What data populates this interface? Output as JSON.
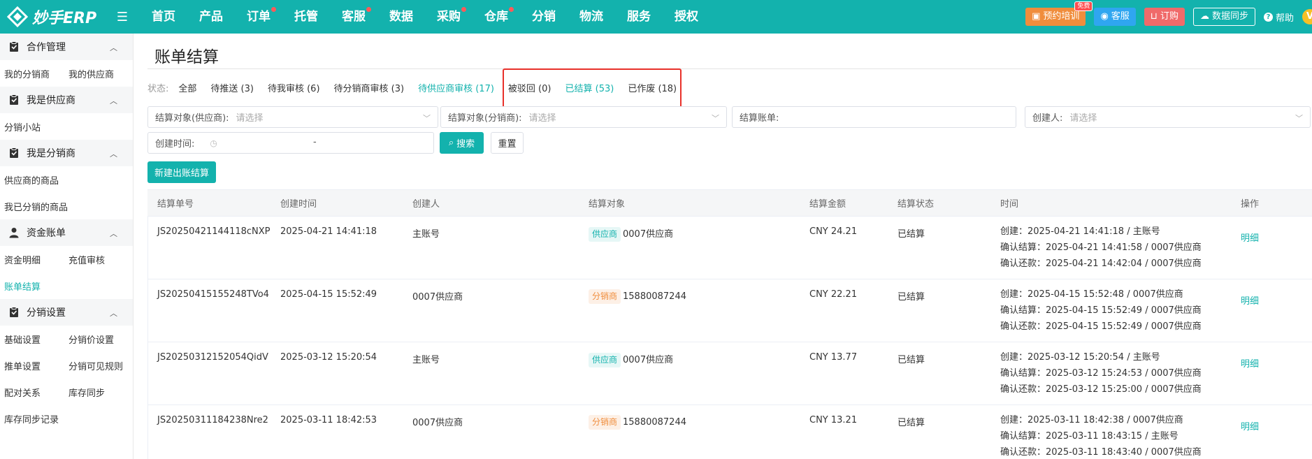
{
  "app": {
    "logo_text": "妙手ERP"
  },
  "nav": {
    "items": [
      {
        "label": "首页",
        "dot": false
      },
      {
        "label": "产品",
        "dot": false
      },
      {
        "label": "订单",
        "dot": true
      },
      {
        "label": "托管",
        "dot": false
      },
      {
        "label": "客服",
        "dot": true
      },
      {
        "label": "数据",
        "dot": false
      },
      {
        "label": "采购",
        "dot": true
      },
      {
        "label": "仓库",
        "dot": true
      },
      {
        "label": "分销",
        "dot": false
      },
      {
        "label": "物流",
        "dot": false
      },
      {
        "label": "服务",
        "dot": false
      },
      {
        "label": "授权",
        "dot": false
      }
    ]
  },
  "topright": {
    "training": "预约培训",
    "free_badge": "免费",
    "service": "客服",
    "order": "订购",
    "sync": "数据同步",
    "help": "帮助",
    "vip": "V"
  },
  "sidebar": {
    "groups": [
      {
        "title": "合作管理",
        "icon": "clipboard-icon",
        "rows": [
          [
            "我的分销商",
            "我的供应商"
          ]
        ]
      },
      {
        "title": "我是供应商",
        "icon": "clipboard-icon",
        "rows": [
          [
            "分销小站"
          ]
        ]
      },
      {
        "title": "我是分销商",
        "icon": "clipboard-icon",
        "rows": [
          [
            "供应商的商品"
          ],
          [
            "我已分销的商品"
          ]
        ]
      },
      {
        "title": "资金账单",
        "icon": "user-icon",
        "rows": [
          [
            "资金明细",
            "充值审核"
          ],
          [
            "账单结算"
          ]
        ]
      },
      {
        "title": "分销设置",
        "icon": "clipboard-icon",
        "rows": [
          [
            "基础设置",
            "分销价设置"
          ],
          [
            "推单设置",
            "分销可见规则"
          ],
          [
            "配对关系",
            "库存同步"
          ],
          [
            "库存同步记录"
          ]
        ]
      }
    ],
    "active_item": "账单结算"
  },
  "page": {
    "title": "账单结算",
    "status_label": "状态:",
    "status_tabs": [
      {
        "label": "全部",
        "active": false
      },
      {
        "label": "待推送 (3)",
        "active": false
      },
      {
        "label": "待我审核 (6)",
        "active": false
      },
      {
        "label": "待分销商审核 (3)",
        "active": false
      },
      {
        "label": "待供应商审核 (17)",
        "active": true
      },
      {
        "label": "被驳回 (0)",
        "active": false
      },
      {
        "label": "已结算 (53)",
        "active": true
      },
      {
        "label": "已作废 (18)",
        "active": false
      }
    ]
  },
  "filters": {
    "supplier": {
      "label": "结算对象(供应商):",
      "placeholder": "请选择"
    },
    "distributor": {
      "label": "结算对象(分销商):",
      "placeholder": "请选择"
    },
    "bill": {
      "label": "结算账单:",
      "placeholder": ""
    },
    "creator": {
      "label": "创建人:",
      "placeholder": "请选择"
    },
    "created_time": {
      "label": "创建时间:",
      "separator": "-"
    },
    "search_btn": "搜索",
    "reset_btn": "重置",
    "new_btn": "新建出账结算"
  },
  "table": {
    "headers": [
      "结算单号",
      "创建时间",
      "创建人",
      "结算对象",
      "结算金额",
      "结算状态",
      "时间",
      "操作"
    ],
    "rows": [
      {
        "id": "JS20250421144118cNXP",
        "created": "2025-04-21 14:41:18",
        "creator": "主账号",
        "target_type": "供应商",
        "target_kind": "supplier",
        "target": "0007供应商",
        "amount": "CNY 24.21",
        "status": "已结算",
        "times": [
          "创建：2025-04-21 14:41:18 / 主账号",
          "确认结算：2025-04-21 14:41:58 / 0007供应商",
          "确认还款：2025-04-21 14:42:04 / 0007供应商"
        ],
        "action": "明细"
      },
      {
        "id": "JS20250415155248TVo4",
        "created": "2025-04-15 15:52:49",
        "creator": "0007供应商",
        "target_type": "分销商",
        "target_kind": "distributor",
        "target": "15880087244",
        "amount": "CNY 22.21",
        "status": "已结算",
        "times": [
          "创建：2025-04-15 15:52:48 / 0007供应商",
          "确认结算：2025-04-15 15:52:49 / 0007供应商",
          "确认还款：2025-04-15 15:52:49 / 0007供应商"
        ],
        "action": "明细"
      },
      {
        "id": "JS20250312152054QidV",
        "created": "2025-03-12 15:20:54",
        "creator": "主账号",
        "target_type": "供应商",
        "target_kind": "supplier",
        "target": "0007供应商",
        "amount": "CNY 13.77",
        "status": "已结算",
        "times": [
          "创建：2025-03-12 15:20:54 / 主账号",
          "确认结算：2025-03-12 15:24:53 / 0007供应商",
          "确认还款：2025-03-12 15:25:00 / 0007供应商"
        ],
        "action": "明细"
      },
      {
        "id": "JS20250311184238Nre2",
        "created": "2025-03-11 18:42:53",
        "creator": "0007供应商",
        "target_type": "分销商",
        "target_kind": "distributor",
        "target": "15880087244",
        "amount": "CNY 13.21",
        "status": "已结算",
        "times": [
          "创建：2025-03-11 18:42:38 / 0007供应商",
          "确认结算：2025-03-11 18:43:15 / 主账号",
          "确认还款：2025-03-11 18:43:40 / 0007供应商"
        ],
        "action": "明细"
      }
    ]
  },
  "colors": {
    "primary": "#13b2ad",
    "highlight_box": "#e8302a"
  }
}
